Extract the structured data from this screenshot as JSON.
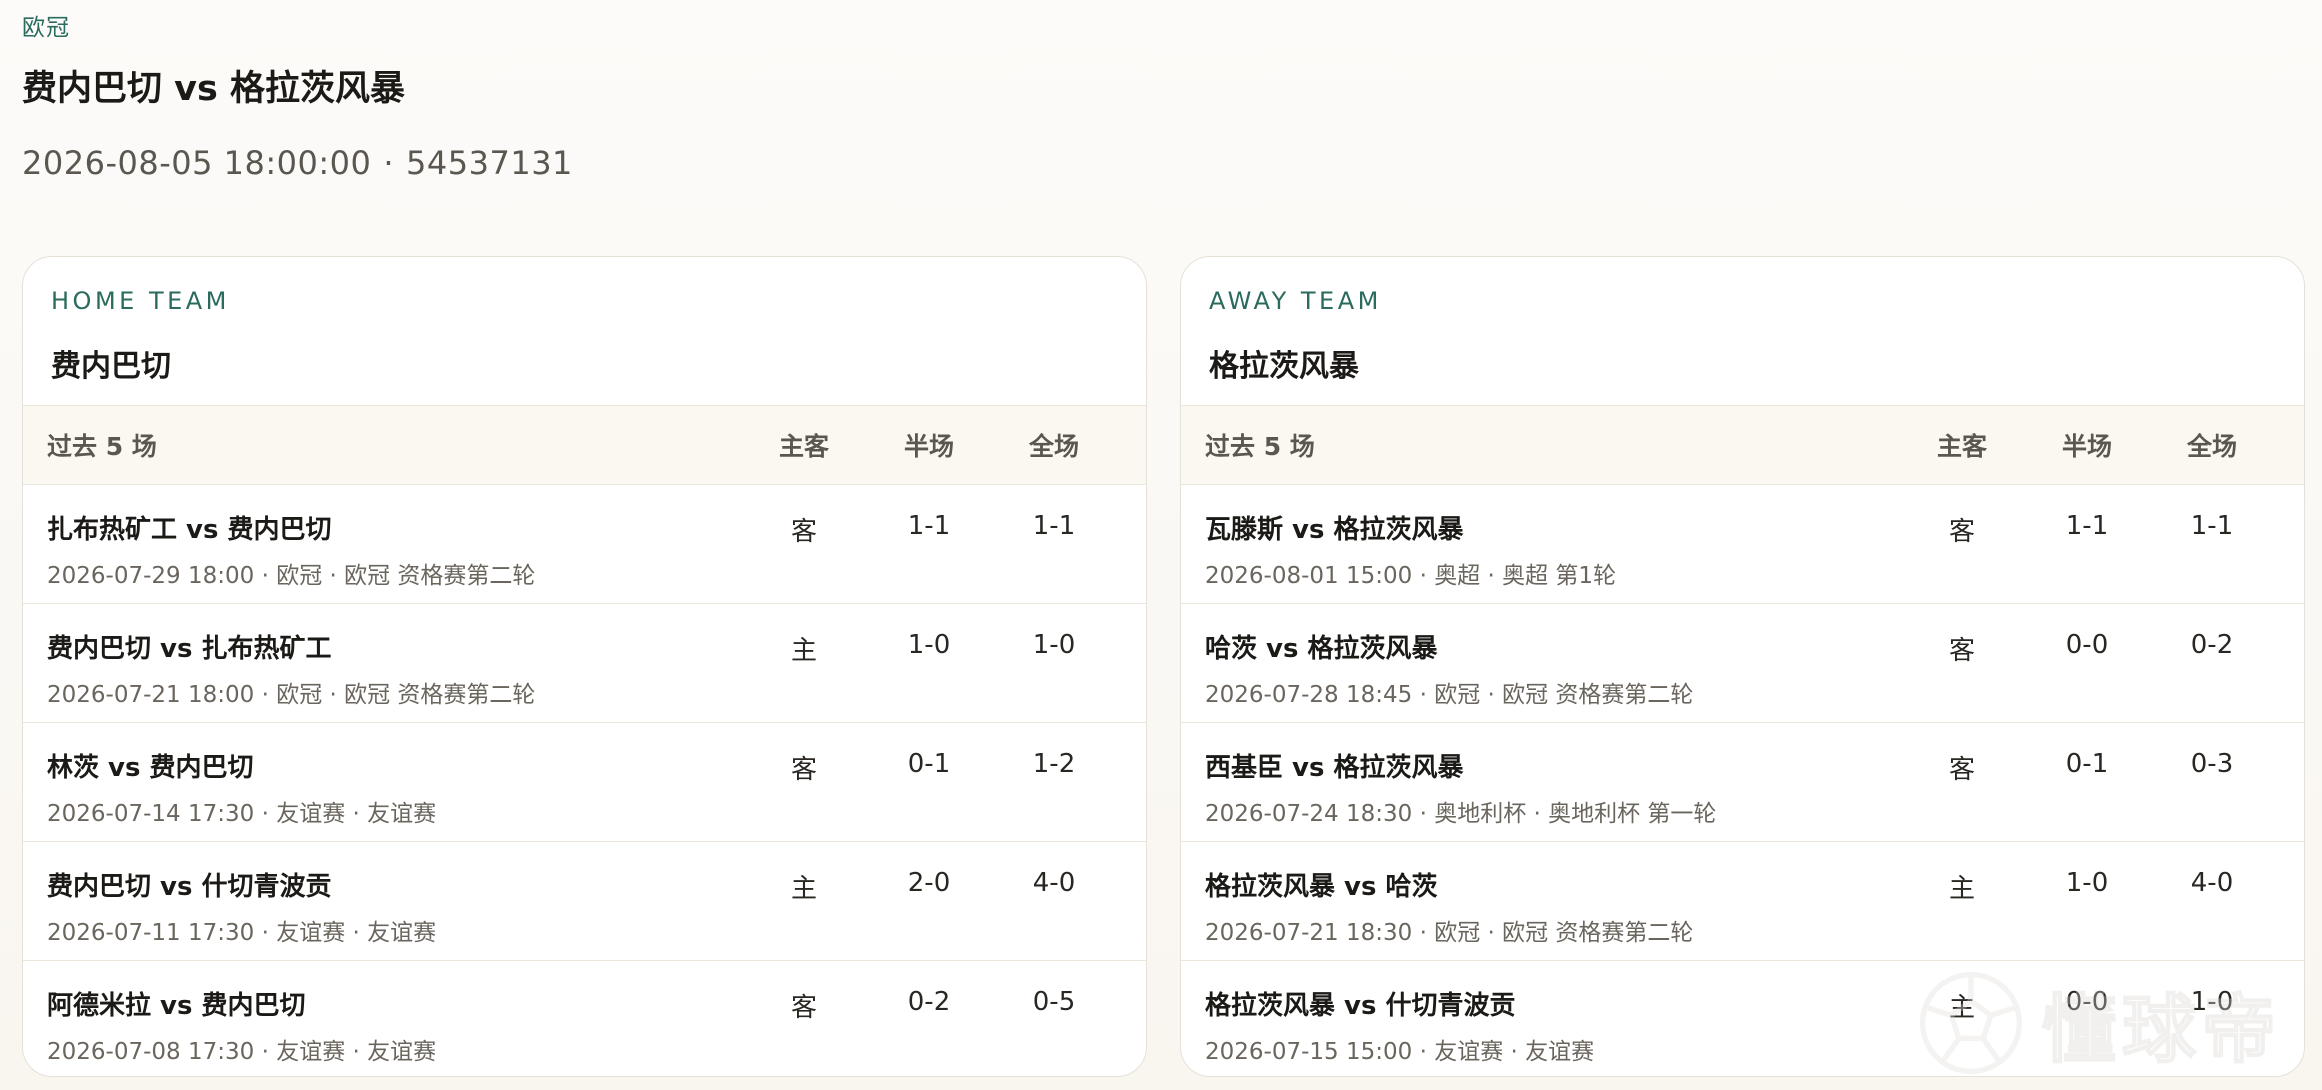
{
  "header": {
    "competition": "欧冠",
    "title": "费内巴切 vs 格拉茨风暴",
    "datetime": "2026-08-05 18:00:00",
    "separator": "·",
    "match_id": "54537131"
  },
  "columns": {
    "match": "过去 5 场",
    "side": "主客",
    "half": "半场",
    "full": "全场"
  },
  "home": {
    "label": "HOME TEAM",
    "name": "费内巴切",
    "matches": [
      {
        "teams": "扎布热矿工 vs 费内巴切",
        "sub": "2026-07-29 18:00 · 欧冠 · 欧冠 资格赛第二轮",
        "side": "客",
        "half": "1-1",
        "full": "1-1"
      },
      {
        "teams": "费内巴切 vs 扎布热矿工",
        "sub": "2026-07-21 18:00 · 欧冠 · 欧冠 资格赛第二轮",
        "side": "主",
        "half": "1-0",
        "full": "1-0"
      },
      {
        "teams": "林茨 vs 费内巴切",
        "sub": "2026-07-14 17:30 · 友谊赛 · 友谊赛",
        "side": "客",
        "half": "0-1",
        "full": "1-2"
      },
      {
        "teams": "费内巴切 vs 什切青波贡",
        "sub": "2026-07-11 17:30 · 友谊赛 · 友谊赛",
        "side": "主",
        "half": "2-0",
        "full": "4-0"
      },
      {
        "teams": "阿德米拉 vs 费内巴切",
        "sub": "2026-07-08 17:30 · 友谊赛 · 友谊赛",
        "side": "客",
        "half": "0-2",
        "full": "0-5"
      }
    ]
  },
  "away": {
    "label": "AWAY TEAM",
    "name": "格拉茨风暴",
    "matches": [
      {
        "teams": "瓦滕斯 vs 格拉茨风暴",
        "sub": "2026-08-01 15:00 · 奥超 · 奥超 第1轮",
        "side": "客",
        "half": "1-1",
        "full": "1-1"
      },
      {
        "teams": "哈茨 vs 格拉茨风暴",
        "sub": "2026-07-28 18:45 · 欧冠 · 欧冠 资格赛第二轮",
        "side": "客",
        "half": "0-0",
        "full": "0-2"
      },
      {
        "teams": "西基臣 vs 格拉茨风暴",
        "sub": "2026-07-24 18:30 · 奥地利杯 · 奥地利杯 第一轮",
        "side": "客",
        "half": "0-1",
        "full": "0-3"
      },
      {
        "teams": "格拉茨风暴 vs 哈茨",
        "sub": "2026-07-21 18:30 · 欧冠 · 欧冠 资格赛第二轮",
        "side": "主",
        "half": "1-0",
        "full": "4-0"
      },
      {
        "teams": "格拉茨风暴 vs 什切青波贡",
        "sub": "2026-07-15 15:00 · 友谊赛 · 友谊赛",
        "side": "主",
        "half": "0-0",
        "full": "1-0"
      }
    ]
  },
  "watermark": {
    "text": "懂球帝",
    "icon": "soccer-ball-icon"
  }
}
